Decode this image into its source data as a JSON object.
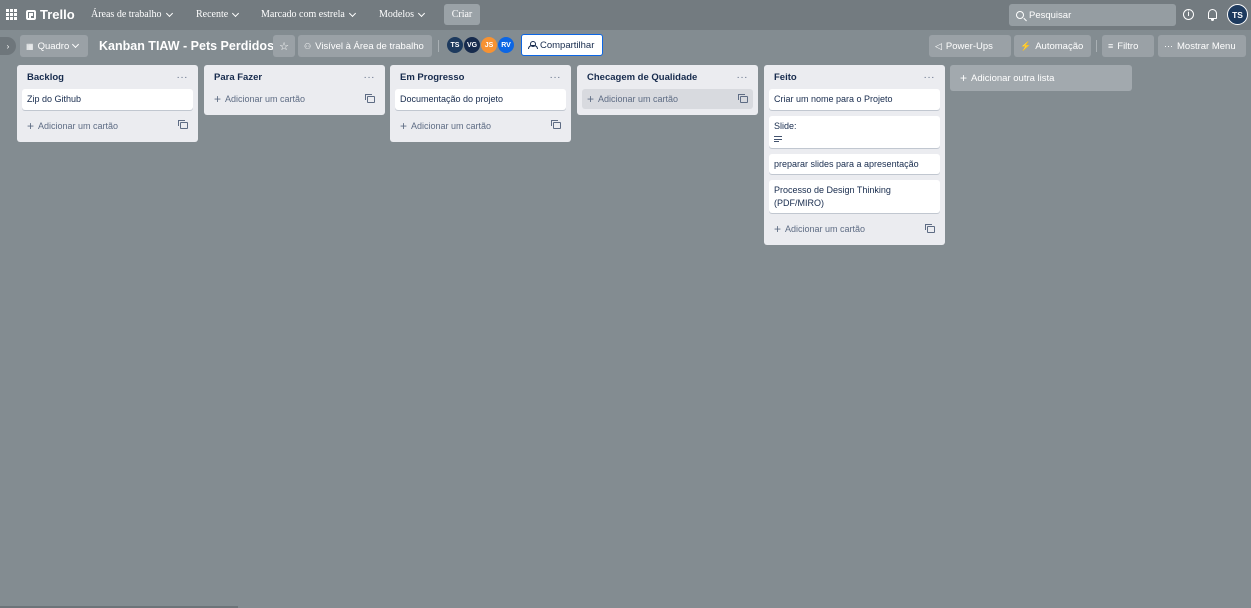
{
  "header": {
    "logo": "Trello",
    "nav": [
      {
        "label": "Áreas de trabalho"
      },
      {
        "label": "Recente"
      },
      {
        "label": "Marcado com estrela"
      },
      {
        "label": "Modelos"
      }
    ],
    "create_label": "Criar",
    "search_placeholder": "Pesquisar",
    "user_initials": "TS"
  },
  "board": {
    "view_label": "Quadro",
    "title": "Kanban TIAW - Pets Perdidos",
    "visibility_label": "Visível à Área de trabalho",
    "members": [
      {
        "initials": "TS",
        "color": "#1d3a5e"
      },
      {
        "initials": "VG",
        "color": "#172b4d"
      },
      {
        "initials": "JS",
        "color": "#f79232"
      },
      {
        "initials": "RV",
        "color": "#0c66e4"
      }
    ],
    "share_label": "Compartilhar",
    "powerups_label": "Power-Ups",
    "automation_label": "Automação",
    "filter_label": "Filtro",
    "menu_label": "Mostrar Menu"
  },
  "lists": [
    {
      "title": "Backlog",
      "cards": [
        "Zip do Github"
      ],
      "add_label": "Adicionar um cartão"
    },
    {
      "title": "Para Fazer",
      "cards": [],
      "add_label": "Adicionar um cartão"
    },
    {
      "title": "Em Progresso",
      "cards": [
        "Documentação do projeto"
      ],
      "add_label": "Adicionar um cartão"
    },
    {
      "title": "Checagem de Qualidade",
      "cards": [],
      "add_label": "Adicionar um cartão"
    },
    {
      "title": "Feito",
      "cards": [
        "Criar um nome para o Projeto",
        "Slide:",
        "preparar slides para a apresentação",
        "Processo de Design Thinking (PDF/MIRO)"
      ],
      "add_label": "Adicionar um cartão"
    }
  ],
  "add_list_label": "Adicionar outra lista"
}
